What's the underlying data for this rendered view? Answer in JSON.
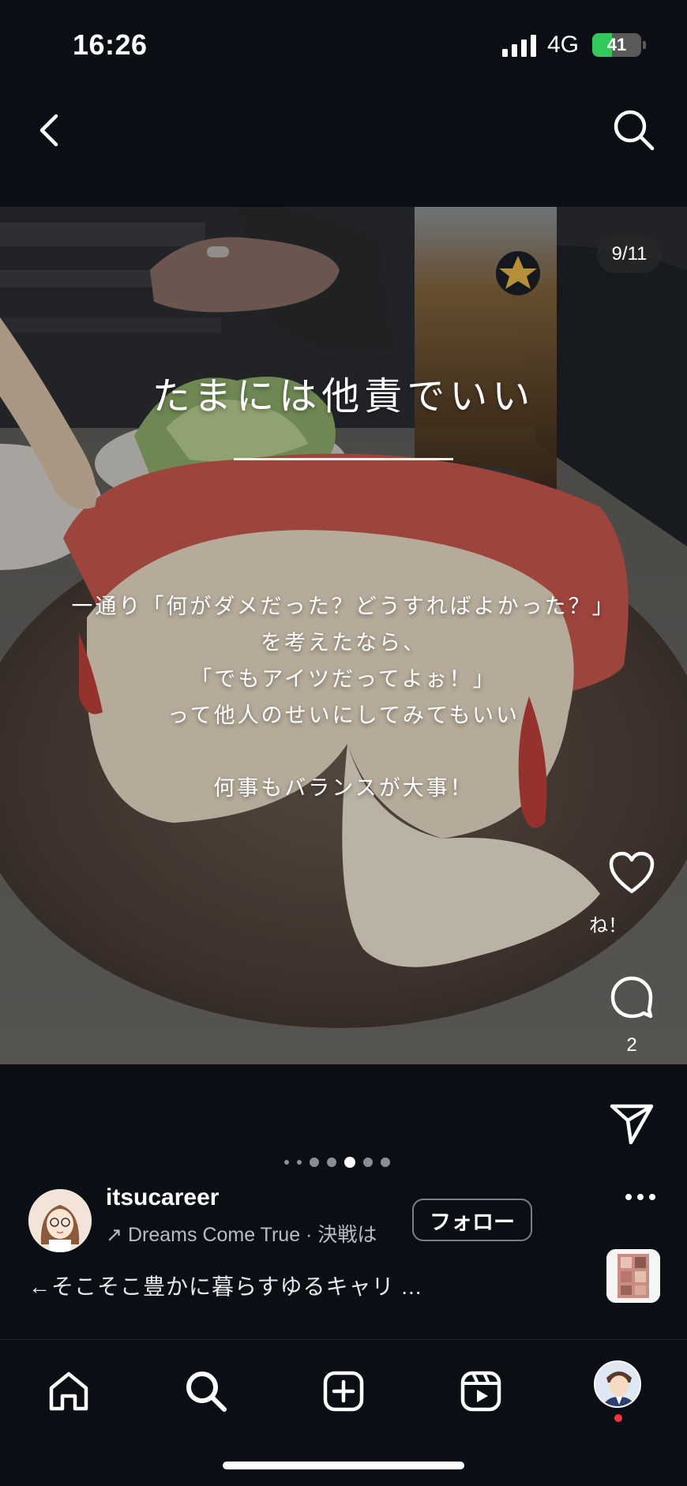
{
  "status_bar": {
    "time": "16:26",
    "network": "4G",
    "battery": "41",
    "battery_level": 0.41
  },
  "post": {
    "counter": "9/11",
    "overlay_title": "たまには他責でいい",
    "overlay_lines": [
      "一通り「何がダメだった？どうすればよかった？」",
      "を考えたなら、",
      "「でもアイツだってよぉ！」",
      "って他人のせいにしてみてもいい",
      "",
      "何事もバランスが大事！"
    ],
    "like_label": "ね！",
    "comment_count": "2",
    "carousel_current": 4,
    "carousel_total": 6
  },
  "author": {
    "username": "itsucareer",
    "music": "Dreams Come True · 決戦は",
    "follow_label": "フォロー"
  },
  "caption": "←そこそこ豊かに暮らすゆるキャリ ...",
  "icons": {
    "back": "chevron-left-icon",
    "search": "search-icon",
    "like": "heart-icon",
    "comment": "comment-icon",
    "share": "paper-plane-icon",
    "more": "ellipsis-icon",
    "tabs": [
      "home-icon",
      "search-icon",
      "add-post-icon",
      "reels-icon",
      "profile-avatar"
    ]
  },
  "colors": {
    "background": "#0b0e14",
    "battery": "#34c759",
    "notification": "#ff3040"
  }
}
